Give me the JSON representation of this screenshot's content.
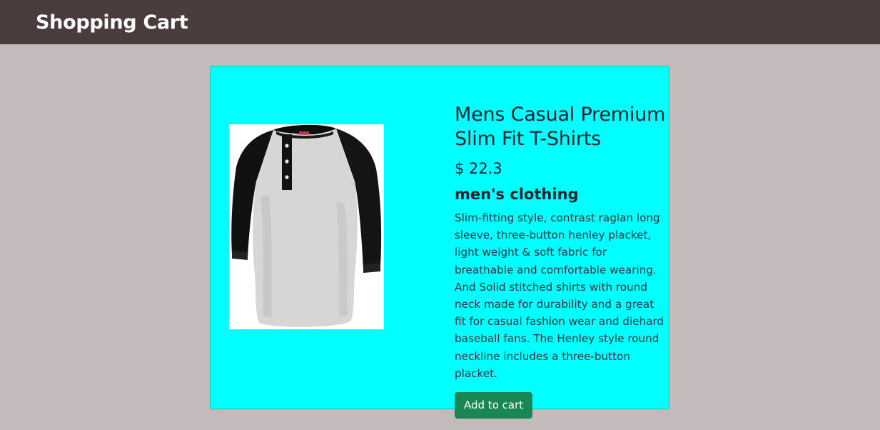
{
  "navbar": {
    "brand": "Shopping Cart"
  },
  "product": {
    "image_icon": "henley-tshirt-image",
    "title": "Mens Casual Premium Slim Fit T-Shirts",
    "price": "$ 22.3",
    "category": "men's clothing",
    "description": "Slim-fitting style, contrast raglan long sleeve, three-button henley placket, light weight & soft fabric for breathable and comfortable wearing. And Solid stitched shirts with round neck made for durability and a great fit for casual fashion wear and diehard baseball fans. The Henley style round neckline includes a three-button placket.",
    "add_to_cart_label": "Add to cart"
  },
  "colors": {
    "navbar_bg": "#4a3c3c",
    "page_bg": "#c3bbbb",
    "card_bg": "#00ffff",
    "button_bg": "#198754"
  }
}
